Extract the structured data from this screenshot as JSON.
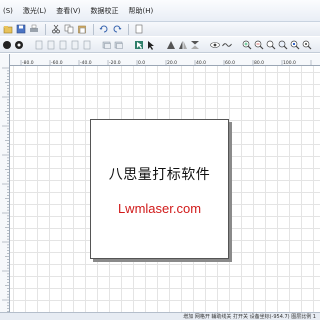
{
  "menu": {
    "items": [
      "(S)",
      "激光(L)",
      "查看(V)",
      "数据校正",
      "帮助(H)"
    ]
  },
  "toolbar": {
    "row1_icons": [
      "open-icon",
      "save-icon",
      "print-icon",
      "sep",
      "cut-icon",
      "copy-icon",
      "paste-icon",
      "sep",
      "undo-icon",
      "redo-icon",
      "sep",
      "file-icon"
    ],
    "row2_icons": [
      "circle-icon",
      "circle-dot-icon",
      "sep",
      "page-icon",
      "page-icon",
      "page-icon",
      "page-icon",
      "page-icon",
      "sep",
      "layer-icon",
      "layer-icon",
      "sep",
      "select-icon",
      "arrow-icon",
      "sep",
      "triangle-icon",
      "flip-horizontal-icon",
      "flip-vertical-icon",
      "sep",
      "eye-icon",
      "wave-icon",
      "sep",
      "zoom-in-icon",
      "zoom-out-icon",
      "zoom-fit-icon",
      "zoom-page-icon",
      "zoom-selection-icon",
      "zoom-all-icon",
      "sep",
      "zoom-reset-icon"
    ]
  },
  "ruler": {
    "labels": [
      "-100.0",
      "-80.0",
      "-60.0",
      "-40.0",
      "-20.0",
      "0.0",
      "20.0",
      "40.0",
      "60.0",
      "80.0",
      "100.0"
    ]
  },
  "canvas": {
    "title": "八思量打标软件",
    "website": "Lwmlaser.com"
  },
  "status": {
    "text": "增加 网格开 辅助线关 打开关 设备坐标(-954.7) 图层比例 1"
  },
  "colors": {
    "accent_red": "#d11a1a",
    "menubar_bg": "#eef2f8",
    "grid": "#e4e4e4"
  }
}
